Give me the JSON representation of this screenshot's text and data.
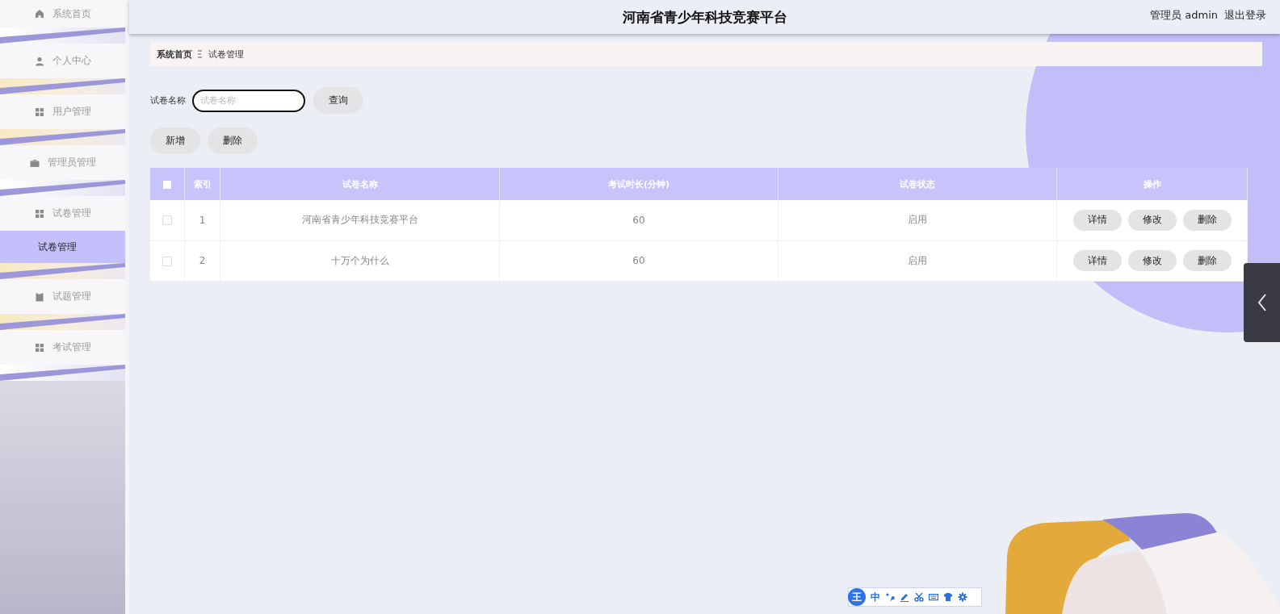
{
  "header": {
    "title": "河南省青少年科技竞赛平台",
    "user": "管理员 admin",
    "logout": "退出登录"
  },
  "sidebar": {
    "items": [
      {
        "label": "系统首页",
        "kind": "home",
        "selected": false
      },
      {
        "label": "个人中心",
        "kind": "user",
        "selected": false
      },
      {
        "label": "用户管理",
        "kind": "grid",
        "selected": false
      },
      {
        "label": "管理员管理",
        "kind": "briefcase",
        "selected": false
      },
      {
        "label": "试卷管理",
        "kind": "grid",
        "selected": false,
        "children": [
          {
            "label": "试卷管理",
            "selected": true
          }
        ]
      },
      {
        "label": "试题管理",
        "kind": "clipboard",
        "selected": false
      },
      {
        "label": "考试管理",
        "kind": "grid",
        "selected": false
      }
    ]
  },
  "breadcrumb": [
    "系统首页",
    "试卷管理"
  ],
  "search": {
    "label": "试卷名称",
    "placeholder": "试卷名称",
    "button": "查询"
  },
  "actions": [
    "新增",
    "删除"
  ],
  "table": {
    "select_all_checked": false,
    "columns": [
      "索引",
      "试卷名称",
      "考试时长(分钟)",
      "试卷状态",
      "操作"
    ],
    "rows": [
      {
        "checked": false,
        "index": "1",
        "name": "河南省青少年科技竞赛平台",
        "duration": "60",
        "status": "启用",
        "actions": [
          "详情",
          "修改",
          "删除"
        ]
      },
      {
        "checked": false,
        "index": "2",
        "name": "十万个为什么",
        "duration": "60",
        "status": "启用",
        "actions": [
          "详情",
          "修改",
          "删除"
        ]
      }
    ]
  },
  "ime_toolbar": {
    "logo": "王",
    "mode": "中"
  }
}
